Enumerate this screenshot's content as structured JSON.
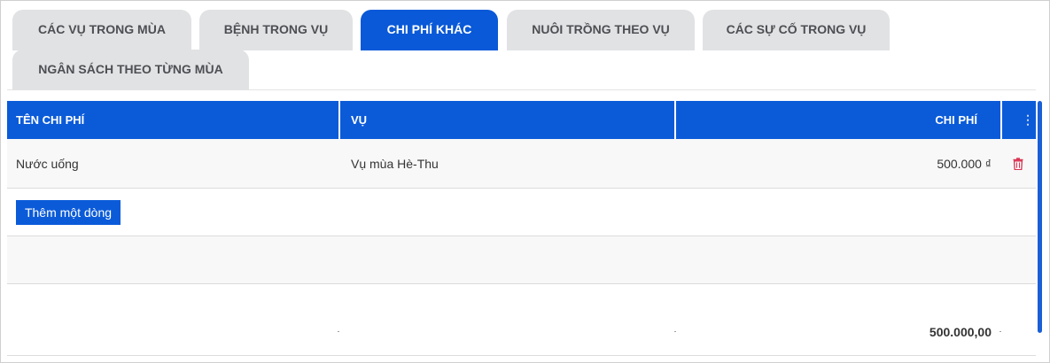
{
  "tabs": [
    {
      "label": "CÁC VỤ TRONG MÙA",
      "active": false
    },
    {
      "label": "BỆNH TRONG VỤ",
      "active": false
    },
    {
      "label": "CHI PHÍ KHÁC",
      "active": true
    },
    {
      "label": "NUÔI TRỒNG THEO VỤ",
      "active": false
    },
    {
      "label": "CÁC SỰ CỐ TRONG VỤ",
      "active": false
    },
    {
      "label": "NGÂN SÁCH THEO TỪNG MÙA",
      "active": false
    }
  ],
  "table": {
    "columns": {
      "name": "TÊN CHI PHÍ",
      "season": "VỤ",
      "cost": "CHI PHÍ"
    },
    "rows": [
      {
        "name": "Nước uống",
        "season": "Vụ mùa Hè-Thu",
        "cost": "500.000 ₫"
      }
    ],
    "add_row_label": "Thêm một dòng",
    "total": "500.000,00"
  },
  "colors": {
    "accent": "#0b5bd9",
    "delete": "#d9304f"
  }
}
